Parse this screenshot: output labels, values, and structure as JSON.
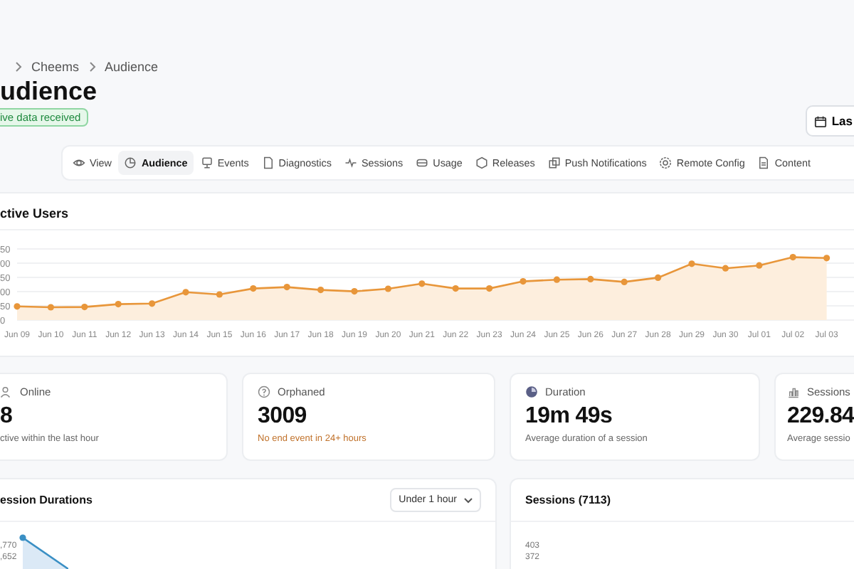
{
  "breadcrumb": [
    "Cheems",
    "Audience"
  ],
  "title": "udience",
  "badge": "ive data received",
  "date_button": "Las",
  "tabs": [
    {
      "label": "View",
      "selected": false
    },
    {
      "label": "Audience",
      "selected": true
    },
    {
      "label": "Events",
      "selected": false
    },
    {
      "label": "Diagnostics",
      "selected": false
    },
    {
      "label": "Sessions",
      "selected": false
    },
    {
      "label": "Usage",
      "selected": false
    },
    {
      "label": "Releases",
      "selected": false
    },
    {
      "label": "Push Notifications",
      "selected": false
    },
    {
      "label": "Remote Config",
      "selected": false
    },
    {
      "label": "Content",
      "selected": false
    }
  ],
  "active_users": {
    "title": "ctive Users",
    "chart_data": {
      "type": "area",
      "grid": true,
      "categories": [
        "Jun 09",
        "Jun 10",
        "Jun 11",
        "Jun 12",
        "Jun 13",
        "Jun 14",
        "Jun 15",
        "Jun 16",
        "Jun 17",
        "Jun 18",
        "Jun 19",
        "Jun 20",
        "Jun 21",
        "Jun 22",
        "Jun 23",
        "Jun 24",
        "Jun 25",
        "Jun 26",
        "Jun 27",
        "Jun 28",
        "Jun 29",
        "Jun 30",
        "Jul 01",
        "Jul 02",
        "Jul 03"
      ],
      "series": [
        {
          "color": "#e8963a",
          "values": [
            48,
            45,
            46,
            56,
            58,
            98,
            90,
            111,
            116,
            106,
            101,
            110,
            128,
            111,
            111,
            136,
            142,
            144,
            134,
            149,
            198,
            182,
            192,
            221,
            218
          ]
        }
      ],
      "ylim": [
        0,
        250
      ],
      "yticks": [
        0,
        50
      ]
    },
    "y_labels_cut": [
      "50",
      "00",
      "50",
      "00"
    ]
  },
  "stats": [
    {
      "label": "Online",
      "value": "8",
      "note": "ctive within the last hour",
      "warning": false
    },
    {
      "label": "Orphaned",
      "value": "3009",
      "note": "No end event in 24+ hours",
      "warning": true
    },
    {
      "label": "Duration",
      "value": "19m 49s",
      "note": "Average duration of a session",
      "warning": false
    },
    {
      "label": "Sessions",
      "value": "229.84",
      "note": "Average sessio",
      "warning": false
    }
  ],
  "session_durations": {
    "title": "ession Durations",
    "filter": "Under 1 hour",
    "y_labels": [
      ",770",
      ",652"
    ]
  },
  "sessions": {
    "title": "Sessions (7113)",
    "y_labels": [
      "403",
      "372"
    ]
  }
}
